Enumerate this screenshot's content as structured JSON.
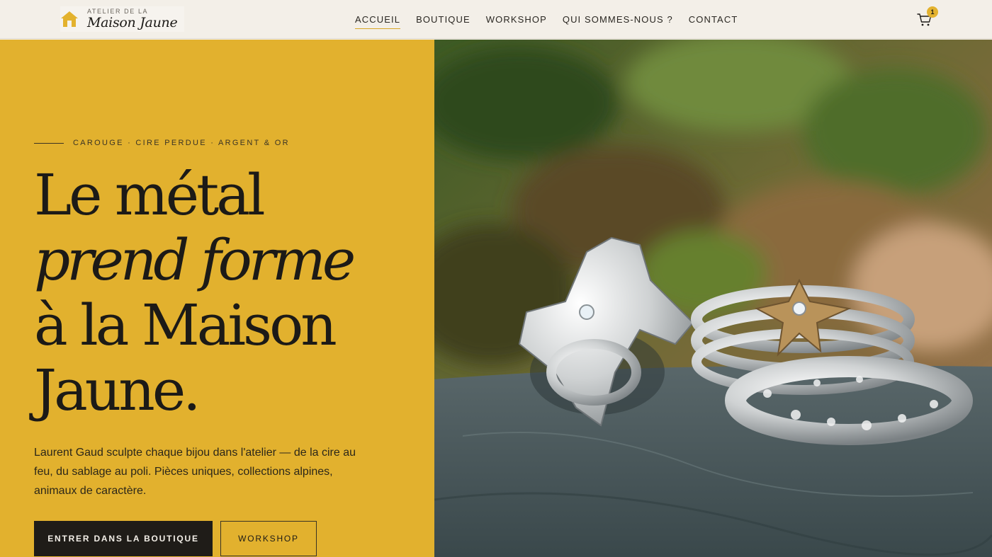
{
  "header": {
    "logo": {
      "small": "ATELIER DE LA",
      "big": "Maison Jaune",
      "icon": "house-icon"
    },
    "nav": [
      {
        "label": "ACCUEIL",
        "active": true
      },
      {
        "label": "BOUTIQUE",
        "active": false
      },
      {
        "label": "WORKSHOP",
        "active": false
      },
      {
        "label": "QUI SOMMES-NOUS ?",
        "active": false
      },
      {
        "label": "CONTACT",
        "active": false
      }
    ],
    "cart": {
      "icon": "cart-icon",
      "count": "1"
    }
  },
  "hero": {
    "eyebrow": "CAROUGE · CIRE PERDUE · ARGENT & OR",
    "headline": {
      "line1": "Le métal",
      "line2": "prend forme",
      "line3": "à la Maison",
      "line4": "Jaune."
    },
    "lede": "Laurent Gaud sculpte chaque bijou dans l'atelier — de la cire au feu, du sablage au poli. Pièces uniques, collections alpines, animaux de caractère.",
    "primary_button": "ENTRER DANS LA BOUTIQUE",
    "secondary_button": "WORKSHOP",
    "image": {
      "subject": "silver-rings-photo"
    }
  },
  "colors": {
    "accent_yellow": "#e2b12e",
    "dark": "#1f1c18",
    "header_bg": "#f3efe8"
  }
}
